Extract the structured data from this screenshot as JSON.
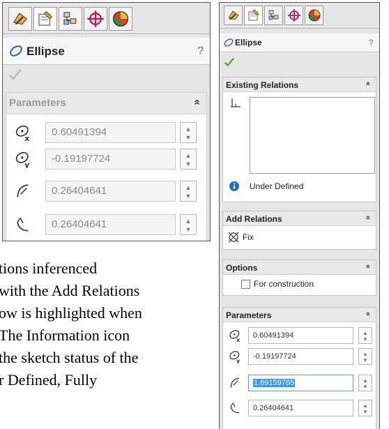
{
  "body_text": {
    "line1": "tions inferenced",
    "line2": "with the Add Relations",
    "line3": "ow is highlighted when",
    "line4": "The Information icon",
    "line5": "the sketch status of the",
    "line6": "r Defined, Fully"
  },
  "left_panel": {
    "tabs": [
      "feature-manager-icon",
      "property-manager-icon",
      "configuration-manager-icon",
      "dimxpert-icon",
      "display-manager-icon"
    ],
    "title": "Ellipse",
    "help": "?",
    "parameters": {
      "header": "Parameters",
      "collapse": "»",
      "center_x": "0.60491394",
      "center_y": "-0.19197724",
      "major_radius": "0.26404641",
      "minor_radius": "0.26404641"
    }
  },
  "right_panel": {
    "tabs": [
      "feature-manager-icon",
      "property-manager-icon",
      "configuration-manager-icon",
      "dimxpert-icon",
      "display-manager-icon"
    ],
    "title": "Ellipse",
    "help": "?",
    "existing_relations": {
      "header": "Existing Relations",
      "collapse": "»",
      "status": "Under Defined"
    },
    "add_relations": {
      "header": "Add Relations",
      "collapse": "»",
      "fix_label": "Fix"
    },
    "options": {
      "header": "Options",
      "collapse": "»",
      "for_construction": "For construction",
      "for_construction_checked": false
    },
    "parameters": {
      "header": "Parameters",
      "collapse": "»",
      "center_x": "0.60491394",
      "center_y": "-0.19197724",
      "major_radius": "1.69159765",
      "minor_radius": "0.26404641"
    }
  },
  "colors": {
    "highlight": "#3399ff",
    "check_green": "#39a92b",
    "info_blue": "#1e72c8"
  }
}
